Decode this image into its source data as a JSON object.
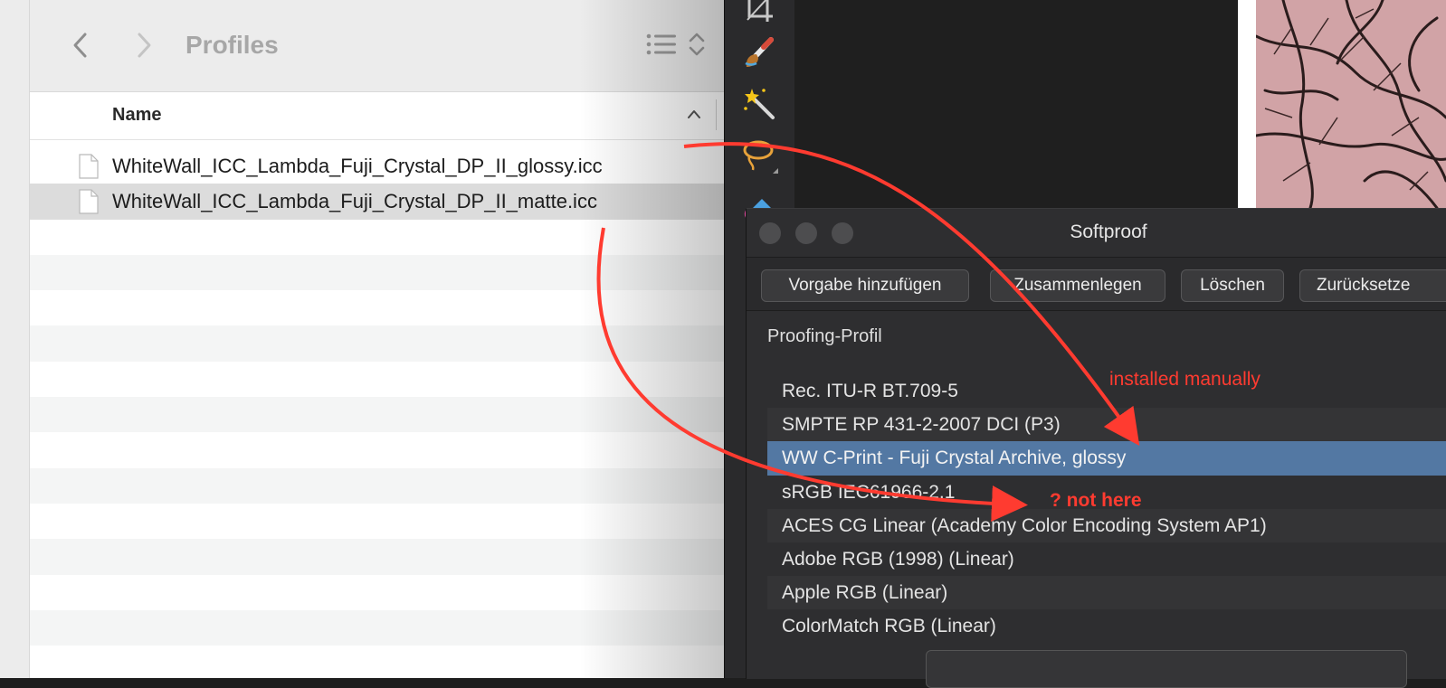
{
  "finder": {
    "title": "Profiles",
    "column_name": "Name",
    "files": [
      {
        "name": "WhiteWall_ICC_Lambda_Fuji_Crystal_DP_II_glossy.icc"
      },
      {
        "name": "WhiteWall_ICC_Lambda_Fuji_Crystal_DP_II_matte.icc"
      }
    ]
  },
  "softproof": {
    "title": "Softproof",
    "buttons": [
      "Vorgabe hinzufügen",
      "Zusammenlegen",
      "Löschen",
      "Zurücksetze"
    ],
    "proofing_label": "Proofing-Profil",
    "profiles": [
      "Rec. ITU-R BT.709-5",
      "SMPTE RP 431-2-2007 DCI (P3)",
      "WW C-Print - Fuji Crystal Archive, glossy",
      "sRGB IEC61966-2.1",
      "ACES CG Linear (Academy Color Encoding System AP1)",
      "Adobe RGB (1998) (Linear)",
      "Apple RGB (Linear)",
      "ColorMatch RGB (Linear)"
    ],
    "selected_index": 2
  },
  "annotations": {
    "installed": "installed manually",
    "not_here": "? not here",
    "color": "#ff3b30"
  },
  "colors": {
    "selection": "#5378a3",
    "finder_selected_row": "#dcdcdc"
  },
  "icons": [
    "chevron-left-icon",
    "chevron-right-icon",
    "list-view-icon",
    "sort-icon",
    "document-icon",
    "crop-icon",
    "paint-brush-icon",
    "magic-wand-icon",
    "lasso-icon",
    "fill-icon"
  ]
}
